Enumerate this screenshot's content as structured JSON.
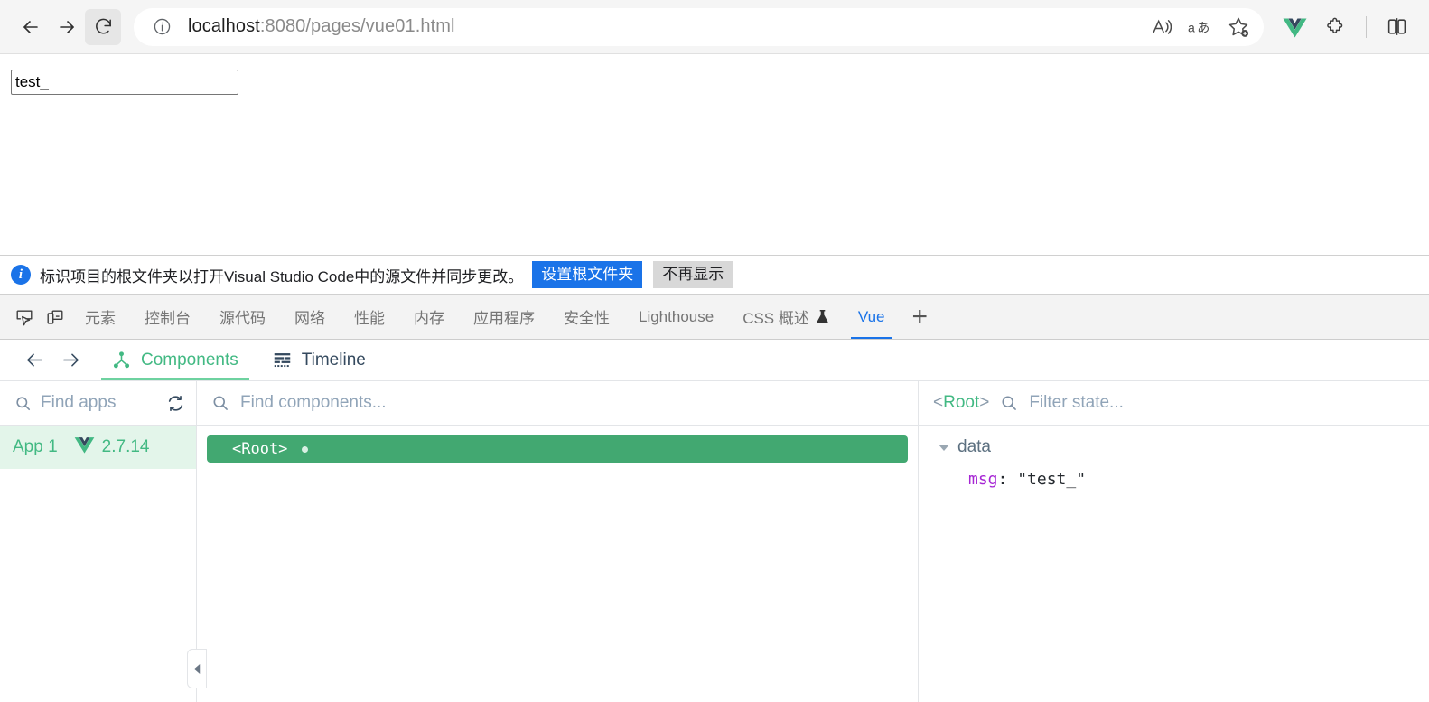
{
  "browser": {
    "nav": {
      "back_label": "Back",
      "forward_label": "Forward",
      "reload_label": "Refresh"
    },
    "omnibox": {
      "info_label": "Site information",
      "url_host": "localhost",
      "url_path": ":8080/pages/vue01.html",
      "read_aloud_label": "Read aloud",
      "translate_label": "aあ",
      "favorite_label": "Add to favorites"
    },
    "extensions": {
      "vue_devtools_label": "Vue.js devtools",
      "puzzle_label": "Extensions",
      "split_label": "Split screen"
    }
  },
  "page": {
    "input_value": "test_",
    "input_placeholder": ""
  },
  "notification": {
    "icon_char": "i",
    "message": "标识项目的根文件夹以打开Visual Studio Code中的源文件并同步更改。",
    "primary_button": "设置根文件夹",
    "secondary_button": "不再显示"
  },
  "devtools": {
    "inspect_label": "检查",
    "device_label": "设备工具栏",
    "tabs": [
      {
        "label": "元素",
        "active": false
      },
      {
        "label": "控制台",
        "active": false
      },
      {
        "label": "源代码",
        "active": false
      },
      {
        "label": "网络",
        "active": false
      },
      {
        "label": "性能",
        "active": false
      },
      {
        "label": "内存",
        "active": false
      },
      {
        "label": "应用程序",
        "active": false
      },
      {
        "label": "安全性",
        "active": false
      },
      {
        "label": "Lighthouse",
        "active": false
      },
      {
        "label": "CSS 概述",
        "active": false,
        "flask": true
      },
      {
        "label": "Vue",
        "active": true
      }
    ],
    "add_tab_label": "+"
  },
  "vue": {
    "back_label": "Back",
    "forward_label": "Forward",
    "tabs": {
      "components": "Components",
      "timeline": "Timeline"
    },
    "apps_search_placeholder": "Find apps",
    "refresh_label": "Refresh",
    "components_search_placeholder": "Find components...",
    "state_root_open": "<",
    "state_root_name": "Root",
    "state_root_close": ">",
    "state_search_placeholder": "Filter state...",
    "app": {
      "name": "App 1",
      "version": "2.7.14"
    },
    "component_tree": [
      {
        "name": "<Root>",
        "selected": true,
        "has_dot": true
      }
    ],
    "state": {
      "group": "data",
      "key": "msg",
      "separator": ": ",
      "value": "\"test_\""
    },
    "collapse_label": "Collapse panel"
  },
  "colors": {
    "vue_green": "#42b983",
    "vue_green_row": "#42a871",
    "app_selected_bg": "#e3f5ea",
    "devtools_blue": "#1a73e8",
    "state_key_purple": "#a626d4"
  }
}
